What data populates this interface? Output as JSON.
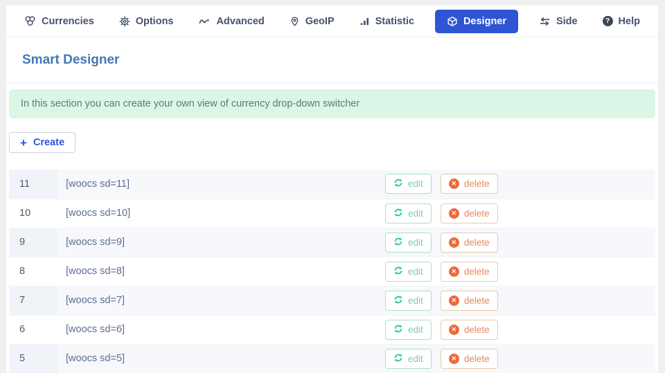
{
  "nav": {
    "items": [
      {
        "label": "Currencies",
        "icon": "coins-icon",
        "active": false
      },
      {
        "label": "Options",
        "icon": "gear-icon",
        "active": false
      },
      {
        "label": "Advanced",
        "icon": "wave-icon",
        "active": false
      },
      {
        "label": "GeoIP",
        "icon": "map-pin-icon",
        "active": false
      },
      {
        "label": "Statistic",
        "icon": "bar-chart-icon",
        "active": false
      },
      {
        "label": "Designer",
        "icon": "cube-icon",
        "active": true
      },
      {
        "label": "Side",
        "icon": "swap-arrows-icon",
        "active": false
      },
      {
        "label": "Help",
        "icon": "question-icon",
        "active": false
      }
    ]
  },
  "page": {
    "title": "Smart Designer"
  },
  "alert": {
    "text": "In this section you can create your own view of currency drop-down switcher"
  },
  "toolbar": {
    "create_label": "Create"
  },
  "icons": {
    "plus": "+",
    "question_mark": "?",
    "close_x": "✕"
  },
  "actions": {
    "edit_label": "edit",
    "delete_label": "delete"
  },
  "table": {
    "rows": [
      {
        "id": "11",
        "shortcode": "[woocs sd=11]"
      },
      {
        "id": "10",
        "shortcode": "[woocs sd=10]"
      },
      {
        "id": "9",
        "shortcode": "[woocs sd=9]"
      },
      {
        "id": "8",
        "shortcode": "[woocs sd=8]"
      },
      {
        "id": "7",
        "shortcode": "[woocs sd=7]"
      },
      {
        "id": "6",
        "shortcode": "[woocs sd=6]"
      },
      {
        "id": "5",
        "shortcode": "[woocs sd=5]"
      }
    ]
  },
  "colors": {
    "primary": "#2f55d4",
    "title": "#4178b6",
    "alert_bg": "#d9f6e7",
    "edit_green": "#2fcf8c",
    "delete_orange": "#ee6a3b",
    "row_stripe": "#f6f8fb"
  }
}
